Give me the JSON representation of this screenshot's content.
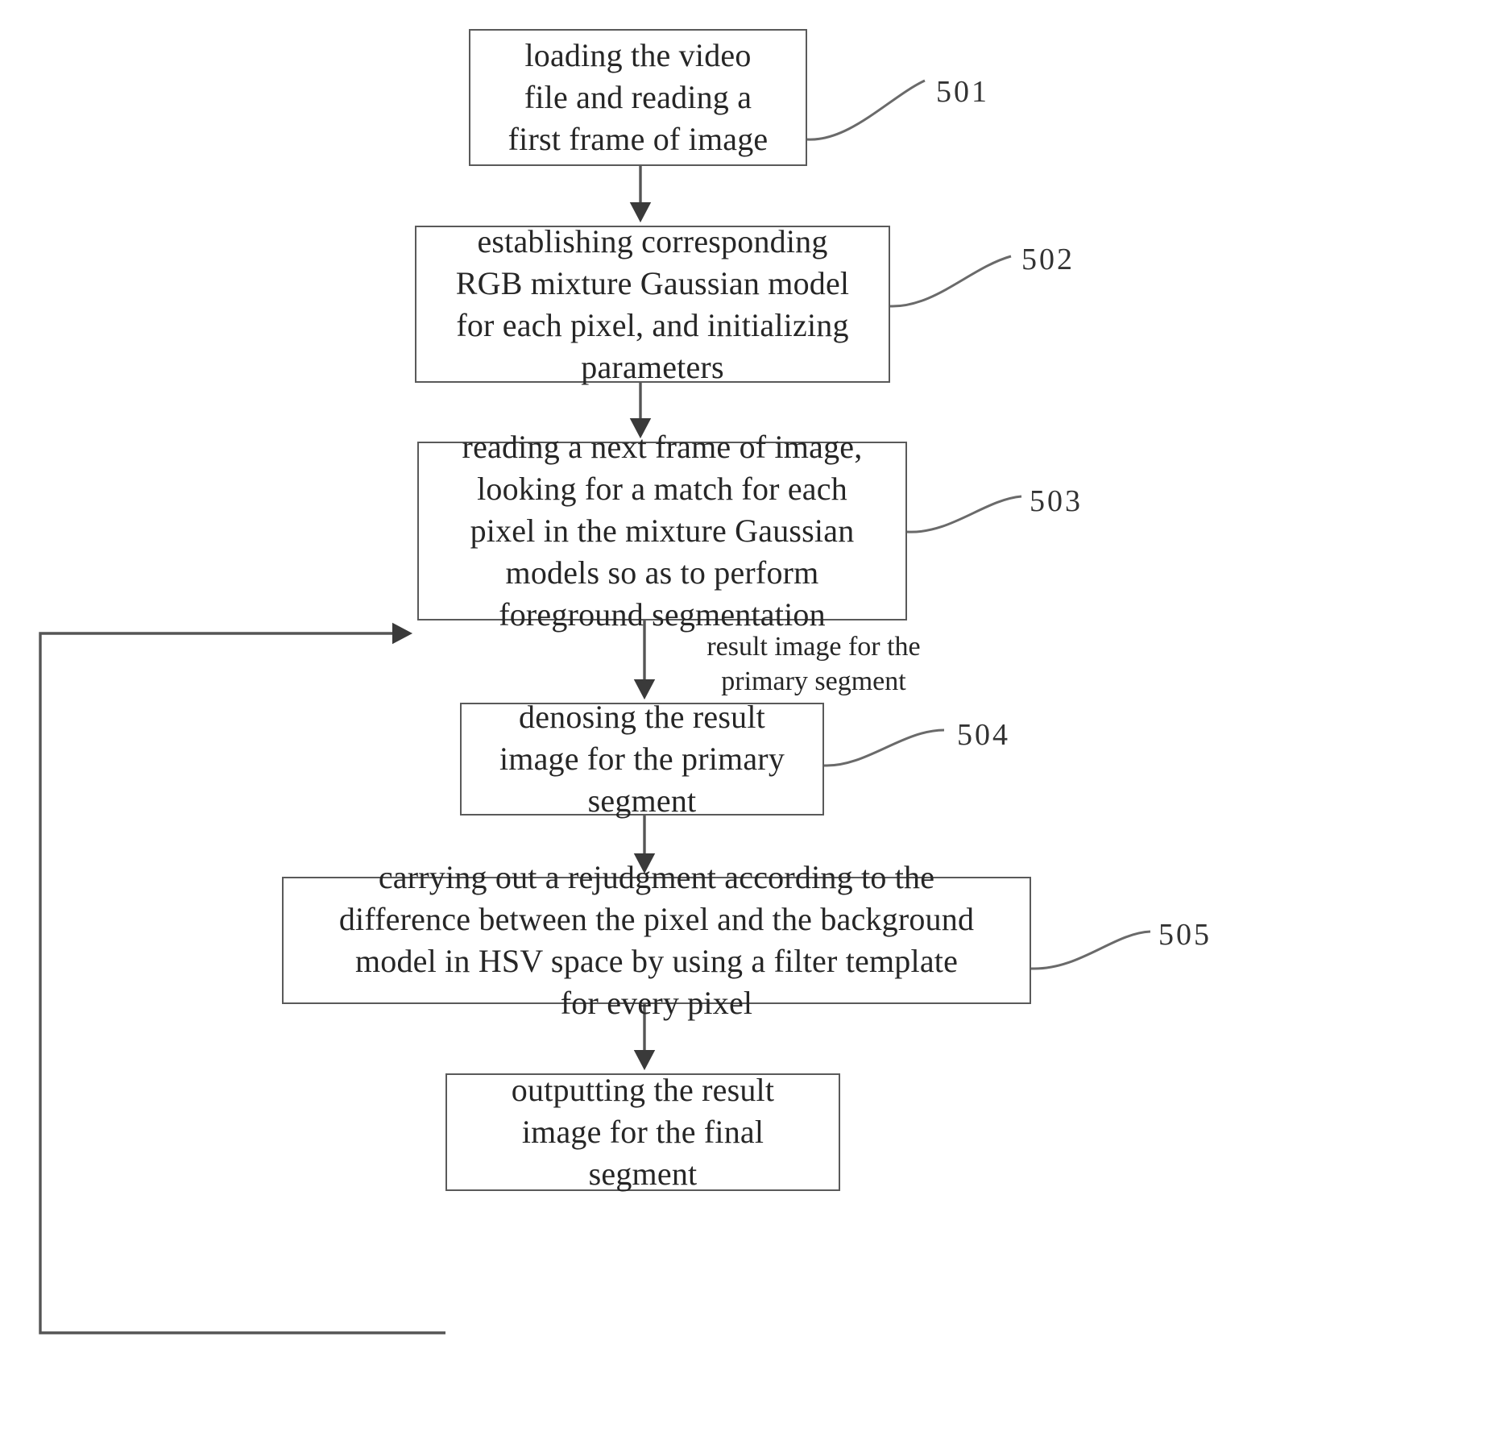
{
  "diagram": {
    "type": "flowchart",
    "title": "",
    "nodes": [
      {
        "id": "501",
        "text": "loading the video\nfile and reading a\nfirst frame of image",
        "step_label": "501"
      },
      {
        "id": "502",
        "text": "establishing corresponding\nRGB mixture Gaussian model\nfor each pixel, and initializing\nparameters",
        "step_label": "502"
      },
      {
        "id": "503",
        "text": "reading a next frame of image,\nlooking for a match for each\npixel in the mixture Gaussian\nmodels so as to perform\nforeground segmentation",
        "step_label": "503"
      },
      {
        "id": "504",
        "text": "denosing the result\nimage for the primary\nsegment",
        "step_label": "504"
      },
      {
        "id": "505",
        "text": "carrying out a rejudgment according to the\ndifference between the pixel and the background\nmodel in HSV space by using a filter template\nfor every pixel",
        "step_label": "505"
      },
      {
        "id": "506",
        "text": "outputting the result\nimage for the final\nsegment",
        "step_label": ""
      }
    ],
    "edge_labels": [
      {
        "id": "primary-segment-label",
        "text": "result image for the\nprimary segment"
      }
    ],
    "colors": {
      "box_border": "#5a5a5a",
      "text": "#262626",
      "connector": "#555555",
      "background": "#ffffff"
    }
  }
}
